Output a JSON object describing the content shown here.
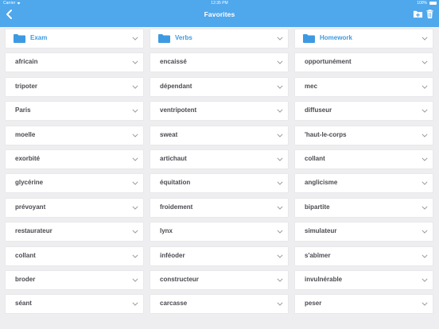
{
  "status": {
    "carrier": "Carrier",
    "time": "12:35 PM",
    "battery": "100%"
  },
  "navbar": {
    "title": "Favorites",
    "back_icon": "chevron-left-icon",
    "add_folder_icon": "folder-plus-icon",
    "trash_icon": "trash-icon"
  },
  "colors": {
    "accent": "#4fa7ec",
    "folder": "#3d9ae2",
    "background": "#eeeef0"
  },
  "folders": [
    {
      "label": "Exam"
    },
    {
      "label": "Verbs"
    },
    {
      "label": "Homework"
    }
  ],
  "words": [
    [
      "africain",
      "encaissé",
      "opportunément"
    ],
    [
      "tripoter",
      "dépendant",
      "mec"
    ],
    [
      "Paris",
      "ventripotent",
      "diffuseur"
    ],
    [
      "moelle",
      "sweat",
      "'haut-le-corps"
    ],
    [
      "exorbité",
      "artichaut",
      "collant"
    ],
    [
      "glycérine",
      "équitation",
      "anglicisme"
    ],
    [
      "prévoyant",
      "froidement",
      "bipartite"
    ],
    [
      "restaurateur",
      "lynx",
      "simulateur"
    ],
    [
      "collant",
      "inféoder",
      "s'abîmer"
    ],
    [
      "broder",
      "constructeur",
      "invulnérable"
    ],
    [
      "séant",
      "carcasse",
      "peser"
    ]
  ]
}
